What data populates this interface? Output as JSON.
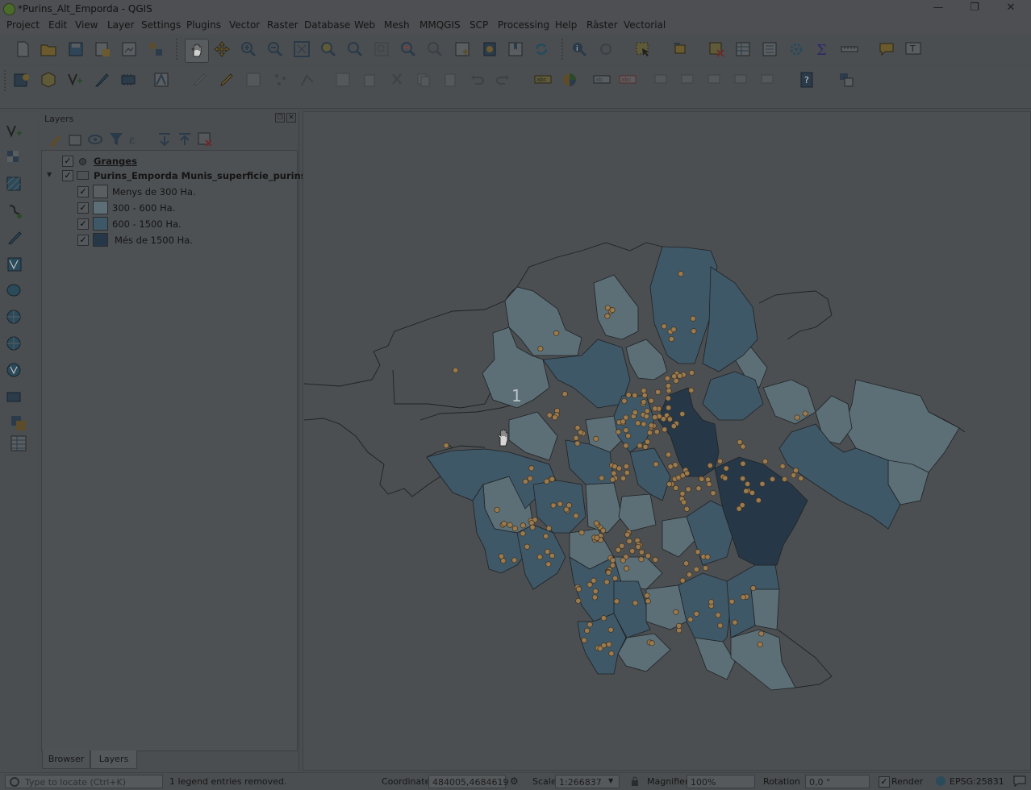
{
  "window": {
    "title": "*Purins_Alt_Emporda - QGIS",
    "minimize": "—",
    "restore": "❐",
    "close": "✕"
  },
  "menu": [
    "Project",
    "Edit",
    "View",
    "Layer",
    "Settings",
    "Plugins",
    "Vector",
    "Raster",
    "Database",
    "Web",
    "Mesh",
    "MMQGIS",
    "SCP",
    "Processing",
    "Help",
    "Ràster",
    "Vectorial"
  ],
  "layers_panel": {
    "title": "Layers",
    "tree": [
      {
        "name": "Granges",
        "checked": true
      },
      {
        "name": "Purins_Emporda Munis_superficie_purins",
        "checked": true,
        "classes": [
          {
            "label": "Menys de 300 Ha.",
            "color": "#5a5e61"
          },
          {
            "label": "300 - 600  Ha.",
            "color": "#5c6f77"
          },
          {
            "label": "600 - 1500 Ha.",
            "color": "#3f5868"
          },
          {
            "label": "Més de 1500 Ha.",
            "color": "#263848"
          }
        ]
      }
    ],
    "tabs": [
      "Browser",
      "Layers"
    ]
  },
  "map": {
    "annotation": "1",
    "colors": {
      "background": "#4c4f52",
      "point": "#9a7a4e",
      "outline": "#1f2224"
    }
  },
  "statusbar": {
    "locate_placeholder": "Type to locate (Ctrl+K)",
    "message": "1 legend entries removed.",
    "coordinate_label": "Coordinate",
    "coordinate_value": "484005,4684619",
    "scale_label": "Scale",
    "scale_value": "1:266837",
    "magnifier_label": "Magnifier",
    "magnifier_value": "100%",
    "rotation_label": "Rotation",
    "rotation_value": "0,0 °",
    "render_label": "Render",
    "crs": "EPSG:25831"
  }
}
